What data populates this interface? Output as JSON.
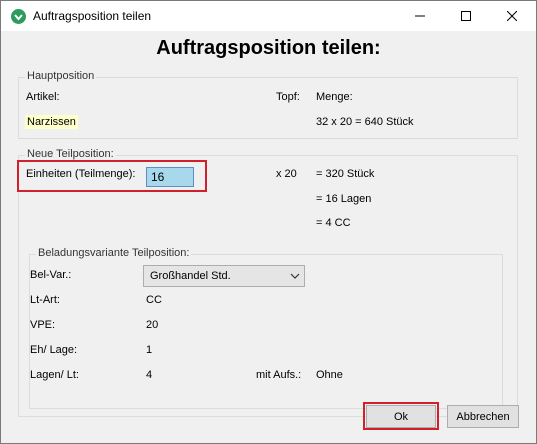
{
  "window": {
    "title": "Auftragsposition teilen",
    "icon": "leaf-app-icon",
    "accent": "#2e9b5e"
  },
  "heading": "Auftragsposition teilen:",
  "hauptposition": {
    "legend": "Hauptposition",
    "artikel_label": "Artikel:",
    "topf_label": "Topf:",
    "menge_label": "Menge:",
    "artikel_value": "Narzissen",
    "menge_value": "32 x 20 = 640 Stück"
  },
  "neue_teilposition": {
    "legend": "Neue Teilposition:",
    "einheiten_label": "Einheiten (Teilmenge):",
    "einheiten_value": "16",
    "multiplier": "x 20",
    "result_stueck": "= 320 Stück",
    "result_lagen": "= 16 Lagen",
    "result_cc": "= 4 CC"
  },
  "beladung": {
    "legend": "Beladungsvariante Teilposition:",
    "belvar_label": "Bel-Var.:",
    "belvar_value": "Großhandel Std.",
    "ltart_label": "Lt-Art:",
    "ltart_value": "CC",
    "vpe_label": "VPE:",
    "vpe_value": "20",
    "ehlage_label": "Eh/ Lage:",
    "ehlage_value": "1",
    "lagenlt_label": "Lagen/ Lt:",
    "lagenlt_value": "4",
    "mitaufs_label": "mit Aufs.:",
    "mitaufs_value": "Ohne"
  },
  "buttons": {
    "ok": "Ok",
    "cancel": "Abbrechen"
  },
  "colors": {
    "highlight_frame": "#d0202c",
    "input_selection": "#a8d8ec",
    "artikel_highlight": "#ffffcc"
  }
}
